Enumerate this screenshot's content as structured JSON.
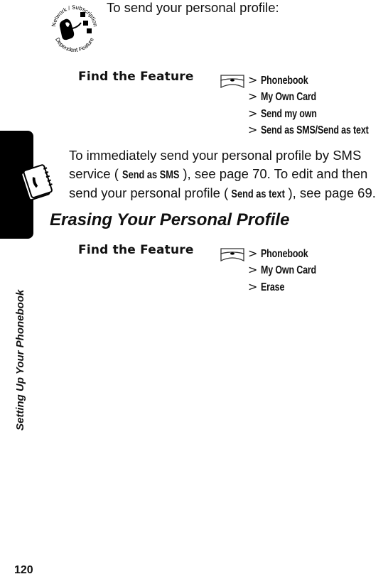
{
  "sidebar": {
    "section_label": "Setting Up Your Phonebook",
    "page_number": "120"
  },
  "icons": {
    "network_feature": "network-subscription-dependent-feature-icon",
    "network_feature_top_text": "Network / Subscription",
    "network_feature_bottom_text": "Dependent Feature",
    "phonebook": "phonebook-icon",
    "menu_key": "menu-key-icon"
  },
  "intro": {
    "text": "To send your personal profile:"
  },
  "find_feature_1": {
    "label": "Find the Feature",
    "path": [
      {
        "sep": ">",
        "item": "Phonebook"
      },
      {
        "sep": ">",
        "item": "My Own Card"
      },
      {
        "sep": ">",
        "item": "Send my own"
      },
      {
        "sep": ">",
        "item": "Send as SMS/Send as text"
      }
    ]
  },
  "paragraph": {
    "part1": "To immediately send your personal profile by SMS service (",
    "cmd1": "Send as SMS",
    "part2": "), see page 70. To edit and then send your personal profile (",
    "cmd2": "Send as text",
    "part3": "), see page 69."
  },
  "section": {
    "heading": "Erasing Your Personal Profile"
  },
  "find_feature_2": {
    "label": "Find the Feature",
    "path": [
      {
        "sep": ">",
        "item": "Phonebook"
      },
      {
        "sep": ">",
        "item": "My Own Card"
      },
      {
        "sep": ">",
        "item": "Erase"
      }
    ]
  }
}
